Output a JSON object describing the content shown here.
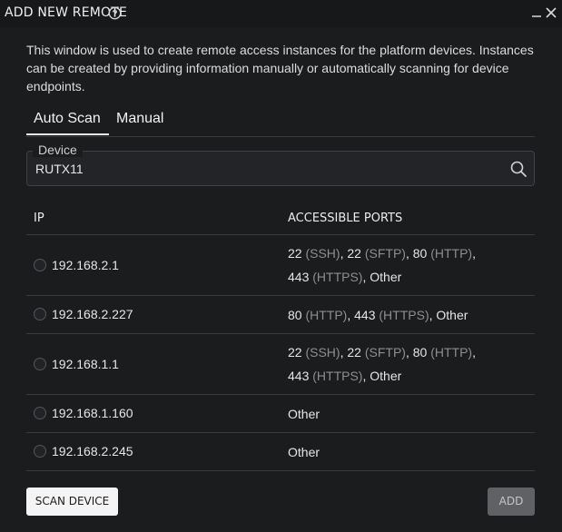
{
  "window": {
    "title": "ADD NEW REMOTE",
    "help_icon": "question-circle-icon",
    "minimize_icon": "minimize-icon",
    "close_icon": "close-icon"
  },
  "description": "This window is used to create remote access instances for the platform devices. Instances can be created by providing information manually or automatically scanning for device endpoints.",
  "tabs": [
    {
      "label": "Auto Scan",
      "active": true
    },
    {
      "label": "Manual",
      "active": false
    }
  ],
  "device": {
    "label": "Device",
    "value": "RUTX11",
    "icon": "search-icon"
  },
  "table": {
    "headers": {
      "ip": "IP",
      "ports": "ACCESSIBLE PORTS"
    },
    "rows": [
      {
        "ip": "192.168.2.1",
        "ports": [
          {
            "port": "22",
            "proto": "(SSH)"
          },
          {
            "port": "22",
            "proto": "(SFTP)"
          },
          {
            "port": "80",
            "proto": "(HTTP)"
          },
          {
            "port": "443",
            "proto": "(HTTPS)"
          },
          {
            "port": "Other",
            "proto": ""
          }
        ]
      },
      {
        "ip": "192.168.2.227",
        "ports": [
          {
            "port": "80",
            "proto": "(HTTP)"
          },
          {
            "port": "443",
            "proto": "(HTTPS)"
          },
          {
            "port": "Other",
            "proto": ""
          }
        ]
      },
      {
        "ip": "192.168.1.1",
        "ports": [
          {
            "port": "22",
            "proto": "(SSH)"
          },
          {
            "port": "22",
            "proto": "(SFTP)"
          },
          {
            "port": "80",
            "proto": "(HTTP)"
          },
          {
            "port": "443",
            "proto": "(HTTPS)"
          },
          {
            "port": "Other",
            "proto": ""
          }
        ]
      },
      {
        "ip": "192.168.1.160",
        "ports": [
          {
            "port": "Other",
            "proto": ""
          }
        ]
      },
      {
        "ip": "192.168.2.245",
        "ports": [
          {
            "port": "Other",
            "proto": ""
          }
        ]
      }
    ]
  },
  "buttons": {
    "scan": "SCAN DEVICE",
    "add": "ADD"
  },
  "colors": {
    "background": "#1b1c1e",
    "proto_text": "#8d8e92",
    "add_disabled": "#606165"
  }
}
